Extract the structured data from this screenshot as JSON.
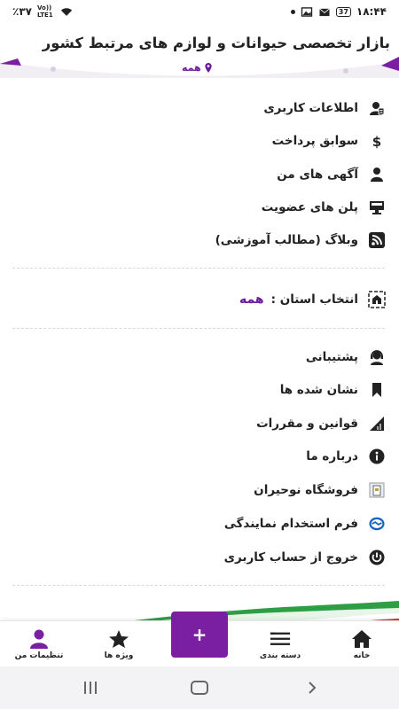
{
  "status_bar": {
    "time": "۱۸:۴۴",
    "battery": "37",
    "battery_percent": "٪۳۷",
    "network": "Vo)) LTE1"
  },
  "header": {
    "title": "بازار تخصصی حیوانات و لوازم های مرتبط کشور",
    "location_label": "همه"
  },
  "menu_group_1": [
    {
      "label": "اطلاعات کاربری",
      "icon": "user-info-icon"
    },
    {
      "label": "سوابق پرداخت",
      "icon": "dollar-icon"
    },
    {
      "label": "آگهی های من",
      "icon": "person-icon"
    },
    {
      "label": "پلن های عضویت",
      "icon": "monitor-icon"
    },
    {
      "label": "وبلاگ (مطالب آموزشی)",
      "icon": "rss-icon"
    }
  ],
  "province": {
    "label": "انتخاب استان :",
    "value": "همه",
    "icon": "map-icon"
  },
  "menu_group_2": [
    {
      "label": "پشتیبانی",
      "icon": "support-icon"
    },
    {
      "label": "نشان شده ها",
      "icon": "bookmark-icon"
    },
    {
      "label": "قوانین و مقررات",
      "icon": "rules-icon"
    },
    {
      "label": "درباره ما",
      "icon": "info-icon"
    },
    {
      "label": "فروشگاه نوحیران",
      "icon": "store-icon"
    },
    {
      "label": "فرم استخدام نمایندگی",
      "icon": "handshake-icon"
    },
    {
      "label": "خروج از حساب کاربری",
      "icon": "power-icon"
    }
  ],
  "bottom_nav": {
    "home": "خانه",
    "categories": "دسته بندی",
    "add": "+",
    "special": "ویژه ها",
    "settings": "تنظیمات من"
  },
  "colors": {
    "accent": "#7b1fa2",
    "accent_text": "#6a1b9a",
    "flag_green": "#2e9e44",
    "flag_red": "#d32f2f"
  }
}
